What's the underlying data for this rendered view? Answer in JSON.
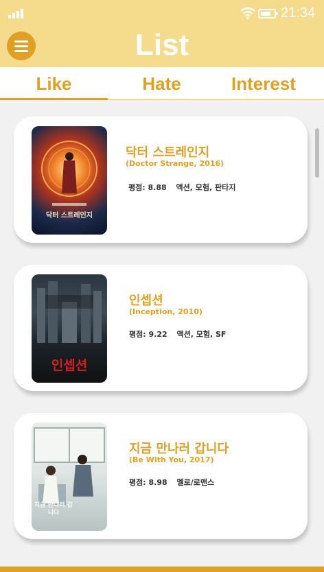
{
  "status_bar": {
    "time": "21:34"
  },
  "header": {
    "title": "List"
  },
  "tabs": [
    {
      "label": "Like",
      "active": true
    },
    {
      "label": "Hate",
      "active": false
    },
    {
      "label": "Interest",
      "active": false
    }
  ],
  "movies": [
    {
      "title": "닥터 스트레인지",
      "subtitle": "(Doctor Strange, 2016)",
      "rating_label": "평점:",
      "rating": "8.88",
      "genres": "액션, 모험, 판타지",
      "poster_text": "닥터 스트레인지"
    },
    {
      "title": "인셉션",
      "subtitle": "(Inception, 2010)",
      "rating_label": "평점:",
      "rating": "9.22",
      "genres": "액션, 모험, SF",
      "poster_text": "인셉션"
    },
    {
      "title": "지금 만나러 갑니다",
      "subtitle": "(Be With You, 2017)",
      "rating_label": "평점:",
      "rating": "8.98",
      "genres": "멜로/로맨스",
      "poster_text": "지금 만나러 갑니다"
    }
  ],
  "colors": {
    "accent": "#e0a024",
    "header_bg": "#f5db8c"
  }
}
